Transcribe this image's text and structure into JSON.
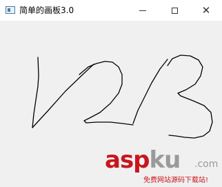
{
  "window": {
    "title": "简单的画板3.0",
    "controls": {
      "minimize": "minimize-icon",
      "maximize": "maximize-icon",
      "close": "close-icon"
    }
  },
  "canvas": {
    "background": "#f0f0f0",
    "stroke_color": "#000000"
  },
  "watermark": {
    "logo_red": "asp",
    "logo_gray": "ku",
    "logo_suffix": ".com",
    "tagline": "免费网站源码下载站!"
  }
}
